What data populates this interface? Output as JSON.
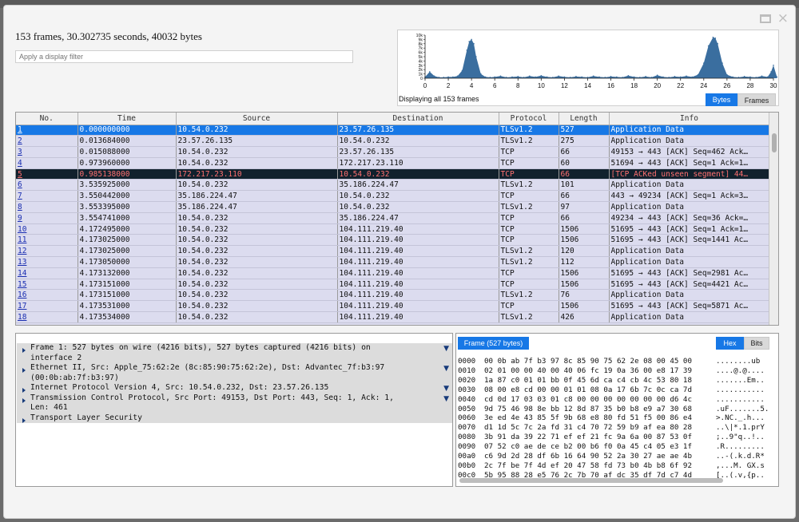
{
  "window": {
    "maximize_icon": "maximize-icon",
    "close_glyph": "×"
  },
  "summary": "153 frames, 30.302735 seconds, 40032 bytes",
  "filter": {
    "placeholder": "Apply a display filter",
    "value": ""
  },
  "io_graph": {
    "caption": "Displaying all 153 frames",
    "toggle": {
      "options": [
        "Bytes",
        "Frames"
      ],
      "selected": "Bytes"
    },
    "accent": "#1778e6",
    "fill": "#3a6e9f"
  },
  "chart_data": {
    "type": "area",
    "x_ticks": [
      "0",
      "2",
      "4",
      "6",
      "8",
      "10",
      "12",
      "14",
      "16",
      "18",
      "20",
      "22",
      "24",
      "26",
      "28",
      "30"
    ],
    "y_ticks": [
      "10k",
      "9k",
      "8k",
      "7k",
      "6k",
      "5k",
      "4k",
      "3k",
      "2k",
      "1k",
      "0"
    ],
    "xlim": [
      0,
      30
    ],
    "ylim": [
      0,
      10000
    ],
    "x": [
      0,
      0.4,
      0.8,
      1.2,
      1.6,
      2,
      2.4,
      2.8,
      3.2,
      3.6,
      3.8,
      4,
      4.2,
      4.4,
      4.8,
      5.2,
      5.6,
      6,
      6.5,
      7,
      7.5,
      8,
      8.5,
      9,
      9.5,
      10,
      10.5,
      11,
      11.5,
      12,
      12.5,
      13,
      13.5,
      14,
      14.5,
      15,
      15.5,
      16,
      16.5,
      17,
      17.5,
      18,
      18.5,
      19,
      19.5,
      20,
      20.5,
      21,
      21.5,
      22,
      22.5,
      23,
      23.5,
      24,
      24.4,
      24.8,
      25,
      25.2,
      25.6,
      26,
      26.5,
      27,
      27.5,
      28,
      28.5,
      29,
      29.5,
      29.8,
      30,
      30.3
    ],
    "y": [
      300,
      1500,
      500,
      200,
      200,
      300,
      300,
      500,
      1800,
      6500,
      8500,
      9000,
      8000,
      5000,
      1000,
      300,
      200,
      300,
      500,
      200,
      300,
      400,
      200,
      500,
      300,
      600,
      300,
      200,
      500,
      300,
      200,
      400,
      300,
      200,
      500,
      300,
      200,
      400,
      300,
      200,
      600,
      300,
      200,
      400,
      200,
      700,
      300,
      200,
      400,
      300,
      500,
      300,
      800,
      3500,
      7500,
      9500,
      9300,
      8000,
      3500,
      800,
      300,
      200,
      400,
      300,
      200,
      500,
      300,
      1500,
      3000,
      300
    ]
  },
  "packet_list": {
    "columns": [
      "No.",
      "Time",
      "Source",
      "Destination",
      "Protocol",
      "Length",
      "Info"
    ],
    "rows": [
      {
        "no": "1",
        "time": "0.000000000",
        "src": "10.54.0.232",
        "dst": "23.57.26.135",
        "proto": "TLSv1.2",
        "len": "527",
        "info": "Application Data",
        "state": "selected"
      },
      {
        "no": "2",
        "time": "0.013684000",
        "src": "23.57.26.135",
        "dst": "10.54.0.232",
        "proto": "TLSv1.2",
        "len": "275",
        "info": "Application Data",
        "state": ""
      },
      {
        "no": "3",
        "time": "0.015088000",
        "src": "10.54.0.232",
        "dst": "23.57.26.135",
        "proto": "TCP",
        "len": "66",
        "info": "49153 → 443 [ACK] Seq=462 Ack…",
        "state": ""
      },
      {
        "no": "4",
        "time": "0.973960000",
        "src": "10.54.0.232",
        "dst": "172.217.23.110",
        "proto": "TCP",
        "len": "60",
        "info": "51694 → 443 [ACK] Seq=1 Ack=1…",
        "state": ""
      },
      {
        "no": "5",
        "time": "0.985138000",
        "src": "172.217.23.110",
        "dst": "10.54.0.232",
        "proto": "TCP",
        "len": "66",
        "info": "[TCP ACKed unseen segment] 44…",
        "state": "error"
      },
      {
        "no": "6",
        "time": "3.535925000",
        "src": "10.54.0.232",
        "dst": "35.186.224.47",
        "proto": "TLSv1.2",
        "len": "101",
        "info": "Application Data",
        "state": ""
      },
      {
        "no": "7",
        "time": "3.550442000",
        "src": "35.186.224.47",
        "dst": "10.54.0.232",
        "proto": "TCP",
        "len": "66",
        "info": "443 → 49234 [ACK] Seq=1 Ack=3…",
        "state": ""
      },
      {
        "no": "8",
        "time": "3.553395000",
        "src": "35.186.224.47",
        "dst": "10.54.0.232",
        "proto": "TLSv1.2",
        "len": "97",
        "info": "Application Data",
        "state": ""
      },
      {
        "no": "9",
        "time": "3.554741000",
        "src": "10.54.0.232",
        "dst": "35.186.224.47",
        "proto": "TCP",
        "len": "66",
        "info": "49234 → 443 [ACK] Seq=36 Ack=…",
        "state": ""
      },
      {
        "no": "10",
        "time": "4.172495000",
        "src": "10.54.0.232",
        "dst": "104.111.219.40",
        "proto": "TCP",
        "len": "1506",
        "info": "51695 → 443 [ACK] Seq=1 Ack=1…",
        "state": ""
      },
      {
        "no": "11",
        "time": "4.173025000",
        "src": "10.54.0.232",
        "dst": "104.111.219.40",
        "proto": "TCP",
        "len": "1506",
        "info": "51695 → 443 [ACK] Seq=1441 Ac…",
        "state": ""
      },
      {
        "no": "12",
        "time": "4.173025000",
        "src": "10.54.0.232",
        "dst": "104.111.219.40",
        "proto": "TLSv1.2",
        "len": "120",
        "info": "Application Data",
        "state": ""
      },
      {
        "no": "13",
        "time": "4.173050000",
        "src": "10.54.0.232",
        "dst": "104.111.219.40",
        "proto": "TLSv1.2",
        "len": "112",
        "info": "Application Data",
        "state": ""
      },
      {
        "no": "14",
        "time": "4.173132000",
        "src": "10.54.0.232",
        "dst": "104.111.219.40",
        "proto": "TCP",
        "len": "1506",
        "info": "51695 → 443 [ACK] Seq=2981 Ac…",
        "state": ""
      },
      {
        "no": "15",
        "time": "4.173151000",
        "src": "10.54.0.232",
        "dst": "104.111.219.40",
        "proto": "TCP",
        "len": "1506",
        "info": "51695 → 443 [ACK] Seq=4421 Ac…",
        "state": ""
      },
      {
        "no": "16",
        "time": "4.173151000",
        "src": "10.54.0.232",
        "dst": "104.111.219.40",
        "proto": "TLSv1.2",
        "len": "76",
        "info": "Application Data",
        "state": ""
      },
      {
        "no": "17",
        "time": "4.173531000",
        "src": "10.54.0.232",
        "dst": "104.111.219.40",
        "proto": "TCP",
        "len": "1506",
        "info": "51695 → 443 [ACK] Seq=5871 Ac…",
        "state": ""
      },
      {
        "no": "18",
        "time": "4.173534000",
        "src": "10.54.0.232",
        "dst": "104.111.219.40",
        "proto": "TLSv1.2",
        "len": "426",
        "info": "Application Data",
        "state": ""
      }
    ]
  },
  "details": {
    "items": [
      {
        "text": "Frame 1: 527 bytes on wire (4216 bits), 527 bytes captured (4216 bits) on",
        "cont": "interface 2",
        "flag": true
      },
      {
        "text": "Ethernet II, Src: Apple_75:62:2e (8c:85:90:75:62:2e), Dst: Advantec_7f:b3:97",
        "cont": "(00:0b:ab:7f:b3:97)",
        "flag": true
      },
      {
        "text": "Internet Protocol Version 4, Src: 10.54.0.232, Dst: 23.57.26.135",
        "cont": "",
        "flag": true
      },
      {
        "text": "Transmission Control Protocol, Src Port: 49153, Dst Port: 443, Seq: 1, Ack: 1,",
        "cont": "Len: 461",
        "flag": true
      },
      {
        "text": "Transport Layer Security",
        "cont": "",
        "flag": false
      }
    ]
  },
  "bytes_pane": {
    "frame_tab": "Frame (527 bytes)",
    "tabs": [
      "Hex",
      "Bits"
    ],
    "selected_tab": "Hex",
    "rows": [
      {
        "off": "0000",
        "hex": "00 0b ab 7f b3 97 8c 85 90 75 62 2e 08 00 45 00",
        "ascii": "........ub"
      },
      {
        "off": "0010",
        "hex": "02 01 00 00 40 00 40 06 fc 19 0a 36 00 e8 17 39",
        "ascii": "....@.@...."
      },
      {
        "off": "0020",
        "hex": "1a 87 c0 01 01 bb 0f 45 6d ca c4 cb 4c 53 80 18",
        "ascii": ".......Em.."
      },
      {
        "off": "0030",
        "hex": "08 00 e8 cd 00 00 01 01 08 0a 17 6b 7c 0c ca 7d",
        "ascii": "..........."
      },
      {
        "off": "0040",
        "hex": "cd 0d 17 03 03 01 c8 00 00 00 00 00 00 00 d6 4c",
        "ascii": "..........."
      },
      {
        "off": "0050",
        "hex": "9d 75 46 98 8e bb 12 8d 87 35 b0 b8 e9 a7 30 68",
        "ascii": ".uF.......5."
      },
      {
        "off": "0060",
        "hex": "3e ed 4e 43 85 5f 9b 68 e8 80 fd 51 f5 00 86 e4",
        "ascii": ">.NC._.h..."
      },
      {
        "off": "0070",
        "hex": "d1 1d 5c 7c 2a fd 31 c4 70 72 59 b9 af ea 80 28",
        "ascii": "..\\|*.1.prY"
      },
      {
        "off": "0080",
        "hex": "3b 91 da 39 22 71 ef ef 21 fc 9a 6a 00 87 53 0f",
        "ascii": ";..9\"q..!.."
      },
      {
        "off": "0090",
        "hex": "07 52 c0 ae de ce b2 00 b6 f0 0a 45 c4 05 e3 1f",
        "ascii": ".R........."
      },
      {
        "off": "00a0",
        "hex": "c6 9d 2d 28 df 6b 16 64 90 52 2a 30 27 ae ae 4b",
        "ascii": "..-(.k.d.R*"
      },
      {
        "off": "00b0",
        "hex": "2c 7f be 7f 4d ef 20 47 58 fd 73 b0 4b b8 6f 92",
        "ascii": ",...M. GX.s"
      },
      {
        "off": "00c0",
        "hex": "5b 95 88 28 e5 76 2c 7b 70 af dc 35 df 7d c7 4d",
        "ascii": "[..(.v,{p.."
      }
    ]
  }
}
